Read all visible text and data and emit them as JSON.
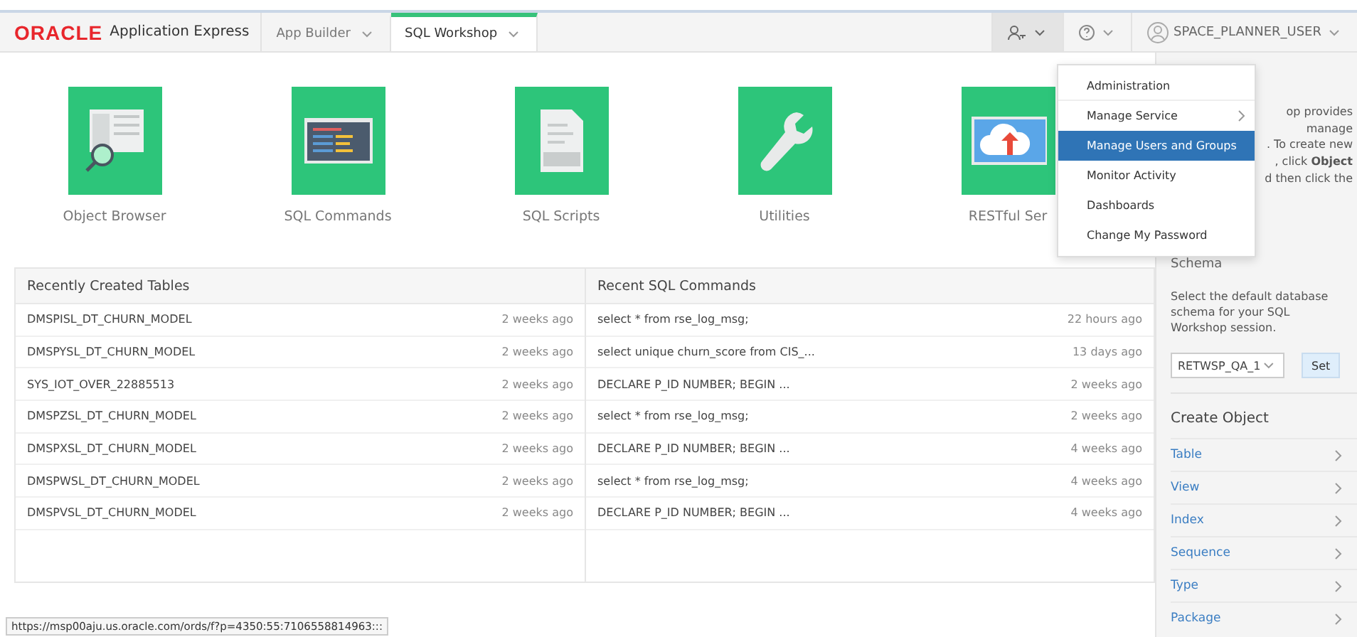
{
  "header": {
    "brand": "ORACLE",
    "product": "Application Express",
    "tabs": [
      {
        "label": "App Builder",
        "selected": false
      },
      {
        "label": "SQL Workshop",
        "selected": true
      }
    ],
    "user": "SPACE_PLANNER_USER"
  },
  "tiles": [
    {
      "label": "Object Browser",
      "kind": "browser"
    },
    {
      "label": "SQL Commands",
      "kind": "commands"
    },
    {
      "label": "SQL Scripts",
      "kind": "scripts"
    },
    {
      "label": "Utilities",
      "kind": "utilities"
    },
    {
      "label": "RESTful Ser",
      "kind": "restful"
    }
  ],
  "admin_menu": {
    "items": [
      {
        "label": "Administration",
        "selected": false,
        "submenu": false
      },
      {
        "label": "Manage Service",
        "selected": false,
        "submenu": true
      },
      {
        "label": "Manage Users and Groups",
        "selected": true,
        "submenu": false
      },
      {
        "label": "Monitor Activity",
        "selected": false,
        "submenu": false
      },
      {
        "label": "Dashboards",
        "selected": false,
        "submenu": false
      },
      {
        "label": "Change My Password",
        "selected": false,
        "submenu": false
      }
    ]
  },
  "recent_tables": {
    "title": "Recently Created Tables",
    "rows": [
      {
        "name": "DMSPISL_DT_CHURN_MODEL",
        "when": "2 weeks ago"
      },
      {
        "name": "DMSPYSL_DT_CHURN_MODEL",
        "when": "2 weeks ago"
      },
      {
        "name": "SYS_IOT_OVER_22885513",
        "when": "2 weeks ago"
      },
      {
        "name": "DMSPZSL_DT_CHURN_MODEL",
        "when": "2 weeks ago"
      },
      {
        "name": "DMSPXSL_DT_CHURN_MODEL",
        "when": "2 weeks ago"
      },
      {
        "name": "DMSPWSL_DT_CHURN_MODEL",
        "when": "2 weeks ago"
      },
      {
        "name": "DMSPVSL_DT_CHURN_MODEL",
        "when": "2 weeks ago"
      }
    ]
  },
  "recent_commands": {
    "title": "Recent SQL Commands",
    "rows": [
      {
        "name": "select * from rse_log_msg;",
        "when": "22 hours ago"
      },
      {
        "name": "select unique churn_score from CIS_...",
        "when": "13 days ago"
      },
      {
        "name": "DECLARE P_ID NUMBER; BEGIN ...",
        "when": "2 weeks ago"
      },
      {
        "name": "select * from rse_log_msg;",
        "when": "2 weeks ago"
      },
      {
        "name": "DECLARE P_ID NUMBER; BEGIN ...",
        "when": "4 weeks ago"
      },
      {
        "name": "select * from rse_log_msg;",
        "when": "4 weeks ago"
      },
      {
        "name": "DECLARE P_ID NUMBER; BEGIN ...",
        "when": "4 weeks ago"
      }
    ]
  },
  "sidebar": {
    "intro_lines": [
      "op provides",
      "manage",
      ". To create new",
      ", click **Object**",
      "d then click the"
    ],
    "schema": {
      "title": "Schema",
      "text": "Select the default database schema for your SQL Workshop session.",
      "value": "RETWSP_QA_1",
      "button": "Set"
    },
    "create_object": {
      "title": "Create Object",
      "items": [
        "Table",
        "View",
        "Index",
        "Sequence",
        "Type",
        "Package"
      ]
    }
  },
  "status_url": "https://msp00aju.us.oracle.com/ords/f?p=4350:55:7106558814963:::"
}
